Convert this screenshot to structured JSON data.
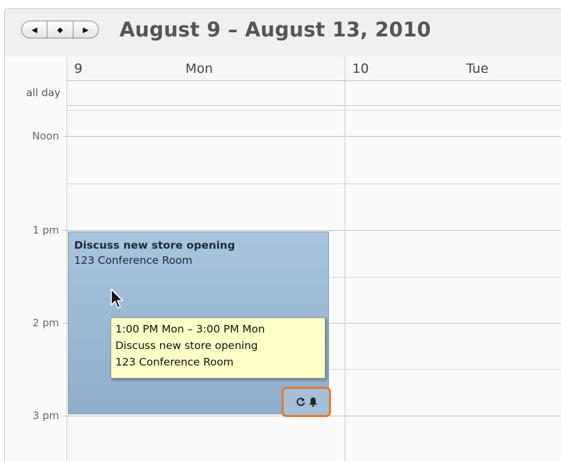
{
  "header": {
    "title": "August 9 – August 13, 2010",
    "nav": {
      "prev": "◀",
      "today": "◆",
      "next": "▶"
    }
  },
  "days": [
    {
      "num": "9",
      "name": "Mon"
    },
    {
      "num": "10",
      "name": "Tue"
    }
  ],
  "time_labels": {
    "all_day": "all day",
    "noon": "Noon",
    "one_pm": "1 pm",
    "two_pm": "2 pm",
    "three_pm": "3 pm"
  },
  "event": {
    "title": "Discuss new store opening",
    "location": "123 Conference Room",
    "color": "#9ab7d3",
    "badge_icons": [
      "repeat-icon",
      "alarm-bell-icon"
    ]
  },
  "tooltip": {
    "time": "1:00 PM Mon – 3:00 PM Mon",
    "title": "Discuss new store opening",
    "location": "123 Conference Room"
  },
  "colors": {
    "highlight_outline": "#e8762a",
    "tooltip_bg": "#ffffc8"
  }
}
